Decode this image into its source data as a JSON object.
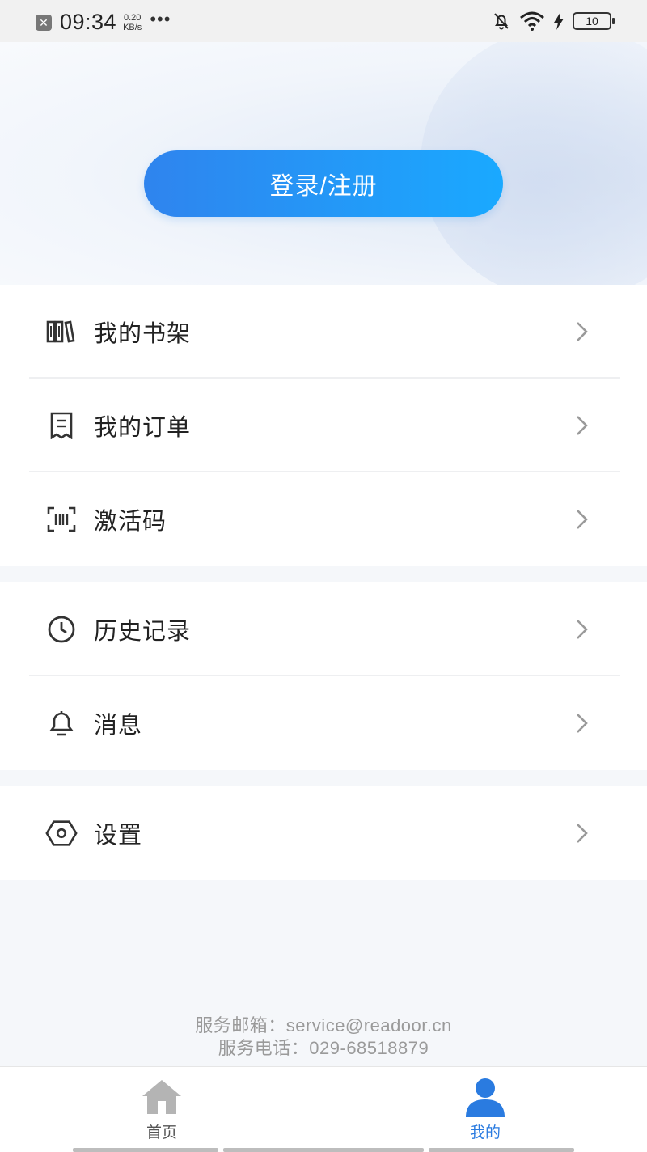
{
  "status_bar": {
    "time": "09:34",
    "speed_value": "0.20",
    "speed_unit": "KB/s",
    "dots": "•••",
    "battery": "10"
  },
  "header": {
    "login_label": "登录/注册"
  },
  "menu": {
    "group1": [
      {
        "label": "我的书架",
        "icon": "bookshelf-icon"
      },
      {
        "label": "我的订单",
        "icon": "order-list-icon"
      },
      {
        "label": "激活码",
        "icon": "scan-code-icon"
      }
    ],
    "group2": [
      {
        "label": "历史记录",
        "icon": "clock-icon"
      },
      {
        "label": "消息",
        "icon": "bell-icon"
      }
    ],
    "group3": [
      {
        "label": "设置",
        "icon": "settings-hexagon-icon"
      }
    ]
  },
  "footer": {
    "email": "服务邮箱：service@readoor.cn",
    "phone": "服务电话：029-68518879"
  },
  "tabbar": {
    "home_label": "首页",
    "mine_label": "我的",
    "active_color": "#2a7be0",
    "inactive_color": "#9e9e9e"
  }
}
